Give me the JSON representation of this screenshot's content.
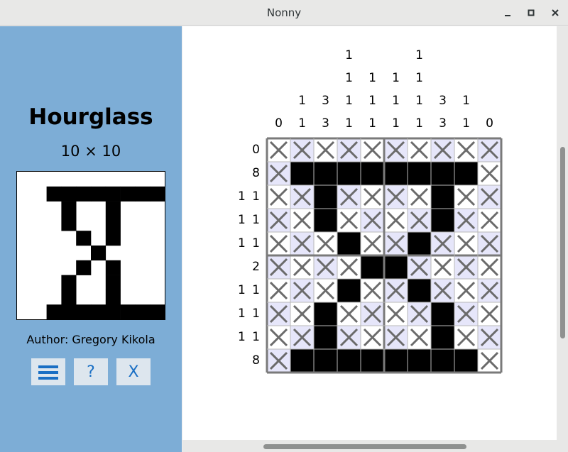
{
  "window": {
    "title": "Nonny"
  },
  "sidebar": {
    "puzzle_title": "Hourglass",
    "puzzle_size": "10 × 10",
    "author": "Author: Gregory Kikola",
    "buttons": [
      {
        "label": "☰",
        "icon": "hamburger-menu-icon"
      },
      {
        "label": "?",
        "icon": "help-icon"
      },
      {
        "label": "X",
        "icon": "close-icon"
      }
    ]
  },
  "puzzle": {
    "column_clues": [
      [
        "0"
      ],
      [
        "1",
        "1"
      ],
      [
        "3",
        "3"
      ],
      [
        "1",
        "1",
        "1",
        "1"
      ],
      [
        "1",
        "1",
        "1"
      ],
      [
        "1",
        "1",
        "1"
      ],
      [
        "1",
        "1",
        "1",
        "1"
      ],
      [
        "3",
        "3"
      ],
      [
        "1",
        "1"
      ],
      [
        "0"
      ]
    ],
    "row_clues": [
      "0",
      "8",
      "1 1",
      "1 1",
      "1 1",
      "2",
      "1 1",
      "1 1",
      "1 1",
      "8"
    ],
    "cells": [
      "XXXXXXXXXX",
      "X########X",
      "XX#XXXX#XX",
      "XX#XXXX#XX",
      "XXX#XX#XXX",
      "XXXX##XXXX",
      "XXX#XX#XXX",
      "XX#XXXX#XX",
      "XX#XXXX#XX",
      "X########X"
    ],
    "preview": [
      "..........",
      "..########",
      "...#..#...",
      "...#..#...",
      "....#.#...",
      ".....#....",
      "....#.#...",
      "...#..#...",
      "...#..#...",
      "..########"
    ]
  }
}
